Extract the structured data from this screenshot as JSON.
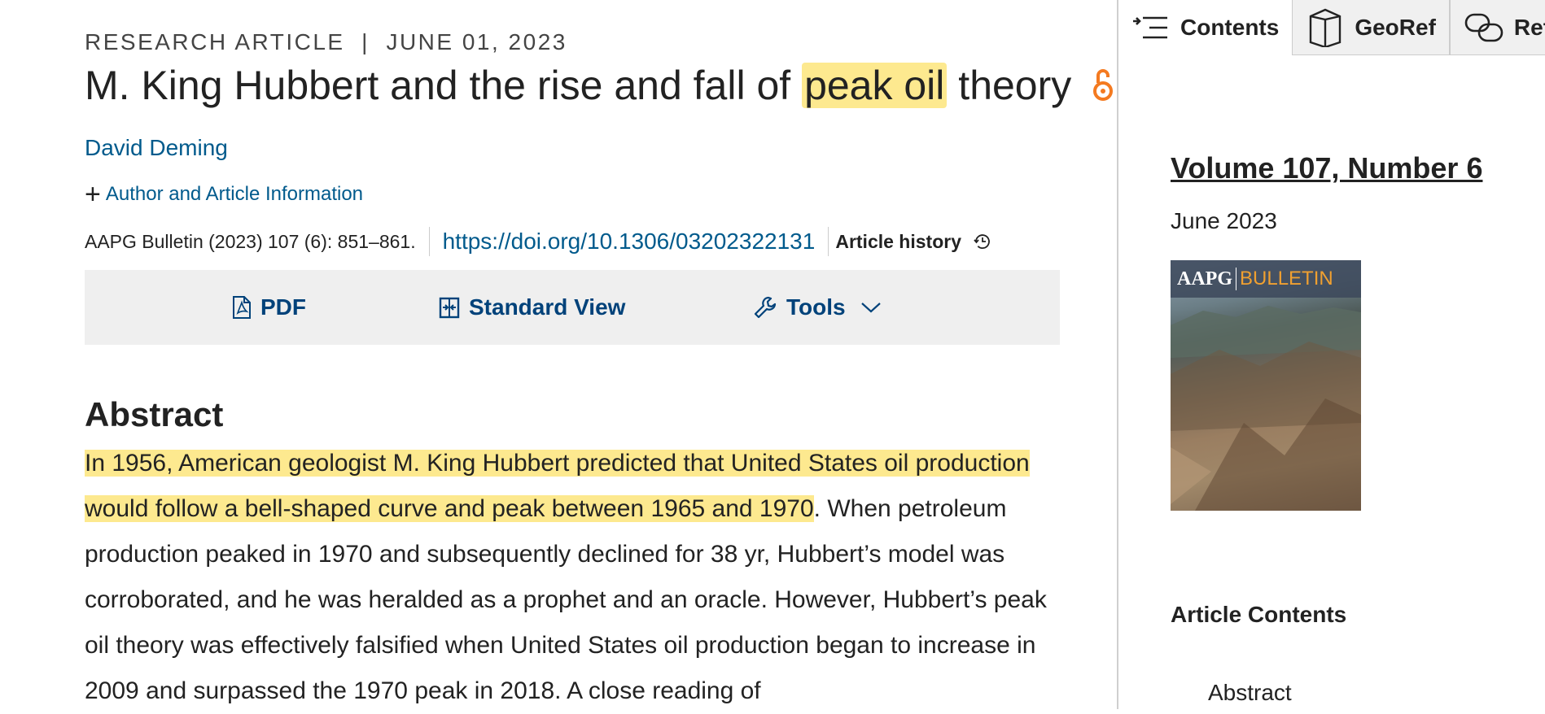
{
  "article": {
    "kicker": "RESEARCH ARTICLE  |  JUNE 01, 2023",
    "title_before": "M. King Hubbert and the rise and fall of ",
    "title_highlight": "peak oil",
    "title_after": " theory",
    "author": "David Deming",
    "author_info_label": "Author and Article Information",
    "citation": "AAPG Bulletin (2023) 107 (6): 851–861.",
    "doi": "https://doi.org/10.1306/03202322131",
    "history_label": "Article history"
  },
  "toolbar": {
    "pdf_label": "PDF",
    "standard_view_label": "Standard View",
    "tools_label": "Tools"
  },
  "abstract": {
    "heading": "Abstract",
    "highlighted": "In 1956, American geologist M. King Hubbert predicted that United States oil production would follow a bell-shaped curve and peak between 1965 and 1970",
    "rest": ". When petroleum production peaked in 1970 and subsequently declined for 38 yr, Hubbert’s model was corroborated, and he was heralded as a prophet and an oracle. However, Hubbert’s peak oil theory was effectively falsified when United States oil production began to increase in 2009 and surpassed the 1970 peak in 2018. A close reading of"
  },
  "sidebar": {
    "tabs": [
      {
        "label": "Contents",
        "icon": "contents-icon"
      },
      {
        "label": "GeoRef",
        "icon": "georef-book-icon"
      },
      {
        "label": "Ref",
        "icon": "references-link-icon"
      }
    ],
    "volume": "Volume 107, Number 6",
    "date": "June 2023",
    "cover": {
      "brand": "AAPG",
      "series": "BULLETIN"
    },
    "contents_heading": "Article Contents",
    "contents_items": [
      "Abstract"
    ]
  },
  "colors": {
    "link": "#005a8c",
    "highlight": "#fde98f",
    "open_access": "#f47a20",
    "toolbar_bg": "#efefef"
  }
}
